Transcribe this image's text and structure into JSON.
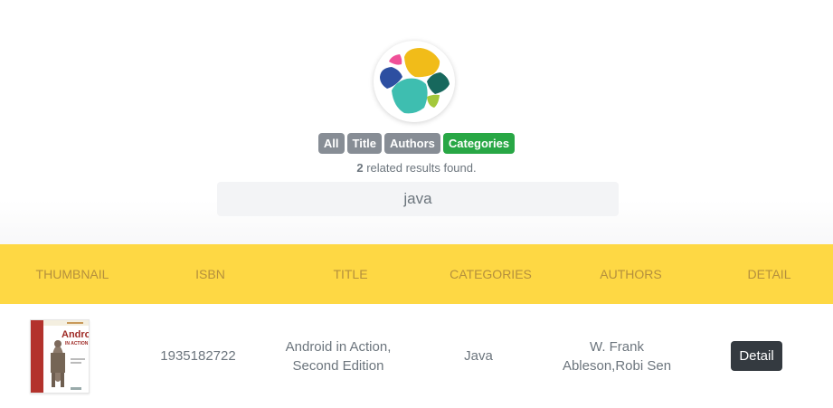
{
  "filters": [
    {
      "label": "All",
      "active": false
    },
    {
      "label": "Title",
      "active": false
    },
    {
      "label": "Authors",
      "active": false
    },
    {
      "label": "Categories",
      "active": true
    }
  ],
  "results": {
    "count": "2",
    "text": " related results found."
  },
  "search": {
    "value": "java"
  },
  "table": {
    "headers": [
      "THUMBNAIL",
      "ISBN",
      "TITLE",
      "CATEGORIES",
      "AUTHORS",
      "DETAIL"
    ],
    "rows": [
      {
        "thumbnail": {
          "title_word": "Android",
          "subtitle": "IN ACTION"
        },
        "isbn": "1935182722",
        "title": "Android in Action, Second Edition",
        "categories": "Java",
        "authors": "W. Frank Ableson,Robi Sen",
        "detail_label": "Detail"
      }
    ]
  },
  "colors": {
    "header_bg": "#fed844",
    "header_text": "#b48f3d",
    "active_filter": "#28a745",
    "inactive_filter": "#878d95",
    "detail_button": "#343a40"
  }
}
